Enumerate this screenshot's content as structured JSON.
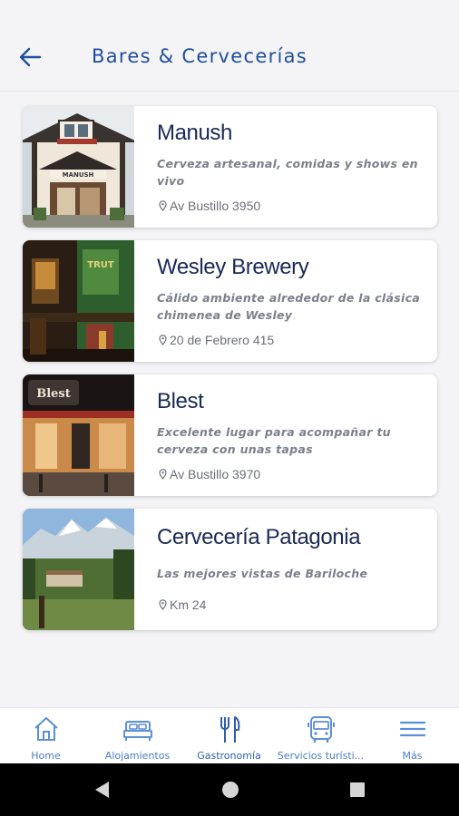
{
  "header": {
    "title": "Bares & Cervecerías"
  },
  "places": [
    {
      "name": "Manush",
      "description": "Cerveza artesanal, comidas y shows en vivo",
      "address": "Av Bustillo 3950"
    },
    {
      "name": "Wesley Brewery",
      "description": "Cálido ambiente alrededor de la clásica chimenea de Wesley",
      "address": "20 de Febrero 415"
    },
    {
      "name": "Blest",
      "description": "Excelente lugar para acompañar tu cerveza con unas tapas",
      "address": "Av Bustillo 3970"
    },
    {
      "name": "Cervecería Patagonia",
      "description": "Las mejores vistas de Bariloche",
      "address": "Km 24"
    }
  ],
  "tabs": [
    {
      "label": "Home",
      "icon": "home-icon"
    },
    {
      "label": "Alojamientos",
      "icon": "bed-icon"
    },
    {
      "label": "Gastronomía",
      "icon": "cutlery-icon",
      "active": true
    },
    {
      "label": "Servicios turísti...",
      "icon": "bus-icon"
    },
    {
      "label": "Más",
      "icon": "menu-icon"
    }
  ],
  "colors": {
    "accent": "#1f4e9c",
    "tab_icon": "#5b8fd6",
    "title_text": "#1a2a57",
    "background": "#f4f4f6"
  }
}
